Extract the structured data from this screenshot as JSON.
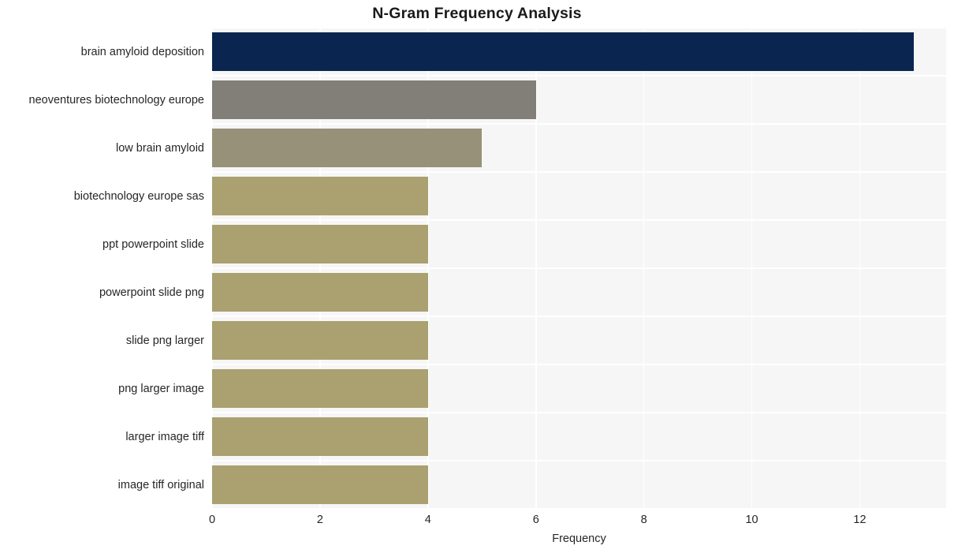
{
  "chart_data": {
    "type": "bar",
    "orientation": "horizontal",
    "title": "N-Gram Frequency Analysis",
    "xlabel": "Frequency",
    "ylabel": "",
    "xlim": [
      0,
      13.6
    ],
    "xticks": [
      0,
      2,
      4,
      6,
      8,
      10,
      12
    ],
    "xtick_labels": [
      "0",
      "2",
      "4",
      "6",
      "8",
      "10",
      "12"
    ],
    "grid": true,
    "legend": false,
    "categories": [
      "brain amyloid deposition",
      "neoventures biotechnology europe",
      "low brain amyloid",
      "biotechnology europe sas",
      "ppt powerpoint slide",
      "powerpoint slide png",
      "slide png larger",
      "png larger image",
      "larger image tiff",
      "image tiff original"
    ],
    "values": [
      13,
      6,
      5,
      4,
      4,
      4,
      4,
      4,
      4,
      4
    ],
    "bar_colors": [
      "#0a2550",
      "#827f78",
      "#969178",
      "#aaa070",
      "#aaa070",
      "#aaa070",
      "#aaa070",
      "#aaa070",
      "#aaa070",
      "#aaa070"
    ]
  },
  "style": {
    "figure_background": "#ffffff",
    "plot_background": "#f6f6f6",
    "gridline_color": "#ffffff",
    "text_color": "#262626",
    "title_color": "#1a1a1a"
  }
}
